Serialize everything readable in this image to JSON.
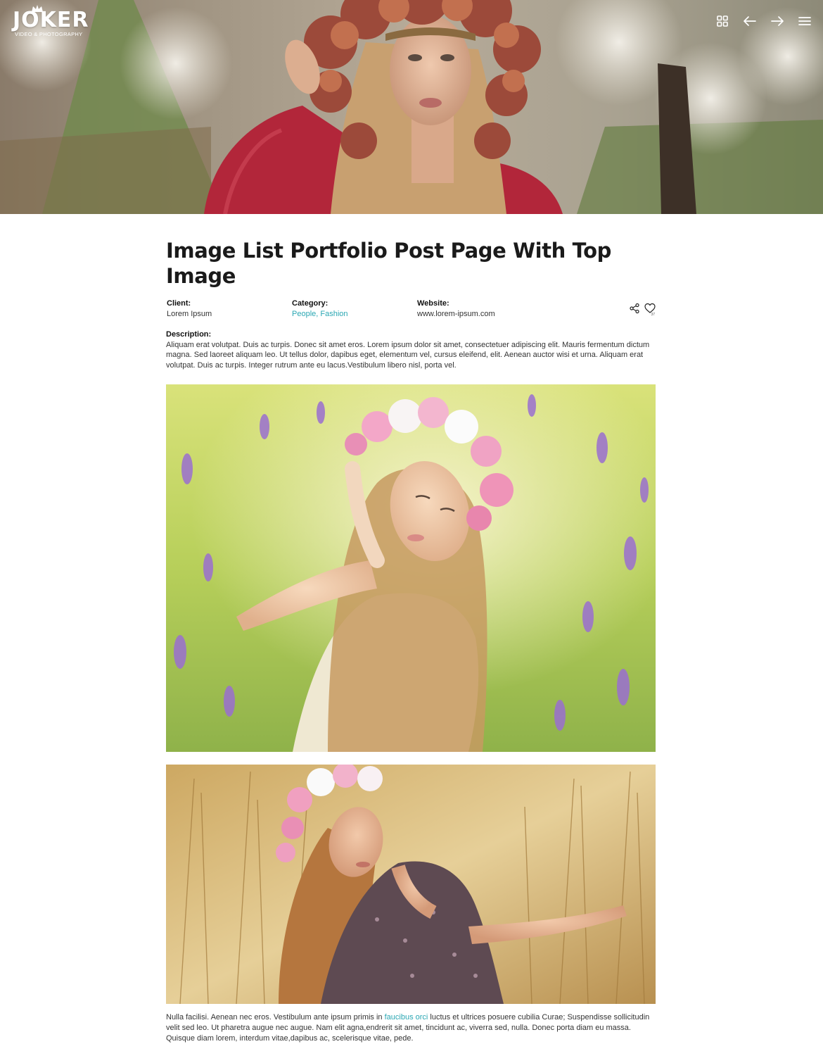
{
  "brand": {
    "name": "JOKER",
    "tagline": "VIDEO & PHOTOGRAPHY"
  },
  "topnav": {
    "icons": [
      "grid-icon",
      "arrow-left-icon",
      "arrow-right-icon",
      "hamburger-menu-icon"
    ]
  },
  "post": {
    "title": "Image List Portfolio Post Page With Top Image",
    "client_label": "Client:",
    "client_value": "Lorem Ipsum",
    "category_label": "Category:",
    "category_1": "People",
    "category_sep": ", ",
    "category_2": "Fashion",
    "website_label": "Website:",
    "website_value": "www.lorem-ipsum.com",
    "like_count": "37",
    "description_label": "Description:",
    "description_text": "Aliquam erat volutpat. Duis ac turpis. Donec sit amet eros. Lorem ipsum dolor sit amet, consectetuer adipiscing elit. Mauris fermentum dictum magna. Sed laoreet aliquam leo. Ut tellus dolor, dapibus eget, elementum vel, cursus eleifend, elit. Aenean auctor wisi et urna. Aliquam erat volutpat. Duis ac turpis. Integer rutrum ante eu lacus.Vestibulum libero nisl, porta vel.",
    "para_before_link": "Nulla facilisi. Aenean nec eros. Vestibulum ante ipsum primis in ",
    "para_link": "faucibus orci",
    "para_after_link": " luctus et ultrices posuere cubilia Curae; Suspendisse sollicitudin velit sed leo. Ut pharetra augue nec augue. Nam elit agna,endrerit sit amet, tincidunt ac, viverra sed, nulla. Donec porta diam eu massa. Quisque diam lorem, interdum vitae,dapibus ac, scelerisque vitae, pede."
  },
  "colors": {
    "accent": "#2aa7b3",
    "title": "#1a1a1a"
  }
}
